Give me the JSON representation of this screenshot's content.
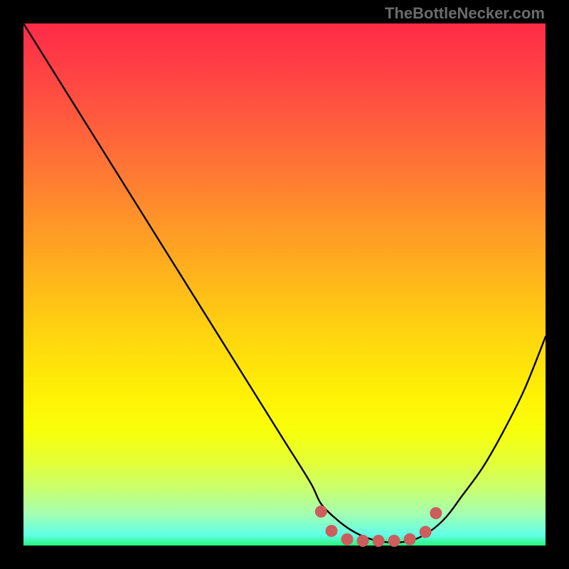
{
  "attribution": "TheBottleNecker.com",
  "chart_data": {
    "type": "line",
    "title": "",
    "xlabel": "",
    "ylabel": "",
    "xlim": [
      0,
      100
    ],
    "ylim": [
      0,
      100
    ],
    "series": [
      {
        "name": "bottleneck-curve",
        "x": [
          0,
          5,
          10,
          15,
          20,
          25,
          30,
          35,
          40,
          45,
          50,
          55,
          57,
          60,
          63,
          66,
          69,
          72,
          75,
          78,
          81,
          84,
          88,
          92,
          96,
          100
        ],
        "y": [
          100,
          92,
          84,
          76,
          68,
          60,
          52,
          44,
          36,
          28,
          20,
          12,
          8,
          5,
          2.8,
          1.4,
          0.7,
          0.6,
          1.2,
          2.8,
          5.5,
          9.5,
          15,
          22,
          30,
          40
        ]
      }
    ],
    "markers": {
      "name": "optimal-range",
      "color": "#cd5c5c",
      "points": [
        {
          "x": 57,
          "y": 6.5
        },
        {
          "x": 59,
          "y": 2.8
        },
        {
          "x": 62,
          "y": 1.2
        },
        {
          "x": 65,
          "y": 0.9
        },
        {
          "x": 68,
          "y": 0.9
        },
        {
          "x": 71,
          "y": 0.9
        },
        {
          "x": 74,
          "y": 1.2
        },
        {
          "x": 77,
          "y": 2.6
        },
        {
          "x": 79,
          "y": 6.2
        }
      ]
    }
  }
}
